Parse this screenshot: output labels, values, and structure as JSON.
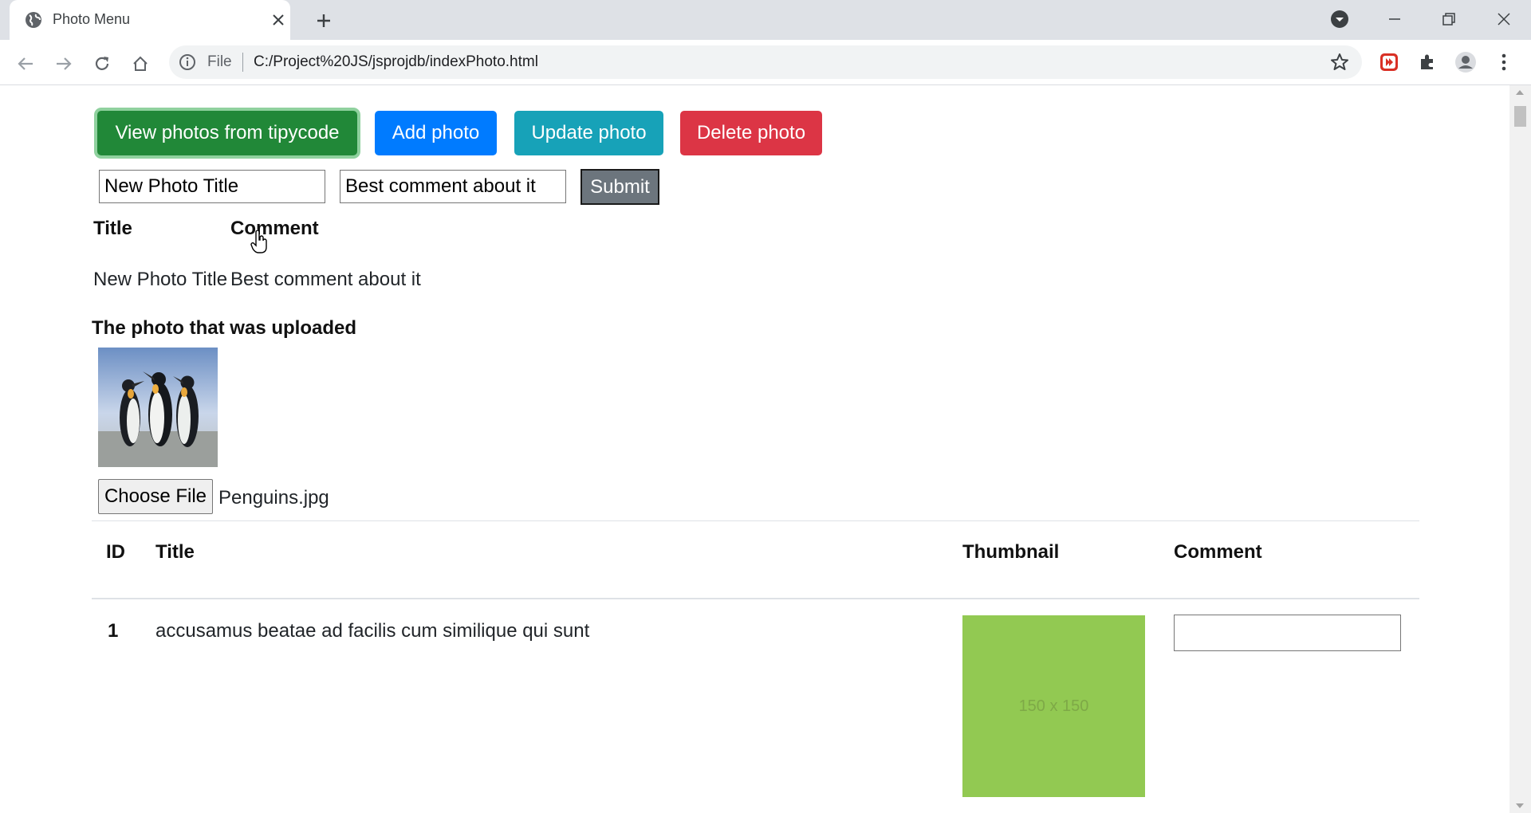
{
  "browser": {
    "tab_title": "Photo Menu",
    "omnibox_scheme": "File",
    "url": "C:/Project%20JS/jsprojdb/indexPhoto.html"
  },
  "toolbar_buttons": {
    "view": "View photos from tipycode",
    "add": "Add photo",
    "update": "Update photo",
    "delete": "Delete photo"
  },
  "form": {
    "title_value": "New Photo Title",
    "comment_value": "Best comment about it",
    "submit_label": "Submit"
  },
  "entry_table": {
    "headers": [
      "Title",
      "Comment"
    ],
    "row": {
      "title": "New Photo Title",
      "comment": "Best comment about it"
    }
  },
  "upload": {
    "heading": "The photo that was uploaded",
    "choose_label": "Choose File",
    "file_name": "Penguins.jpg"
  },
  "photos_table": {
    "headers": {
      "id": "ID",
      "title": "Title",
      "thumbnail": "Thumbnail",
      "comment": "Comment"
    },
    "rows": [
      {
        "id": "1",
        "title": "accusamus beatae ad facilis cum similique qui sunt",
        "thumbnail_text": "150 x 150",
        "thumbnail_color": "#92c952",
        "comment": ""
      }
    ]
  },
  "colors": {
    "success": "#218838",
    "primary": "#007bff",
    "info": "#17a2b8",
    "danger": "#dc3545",
    "secondary": "#6c757d"
  }
}
